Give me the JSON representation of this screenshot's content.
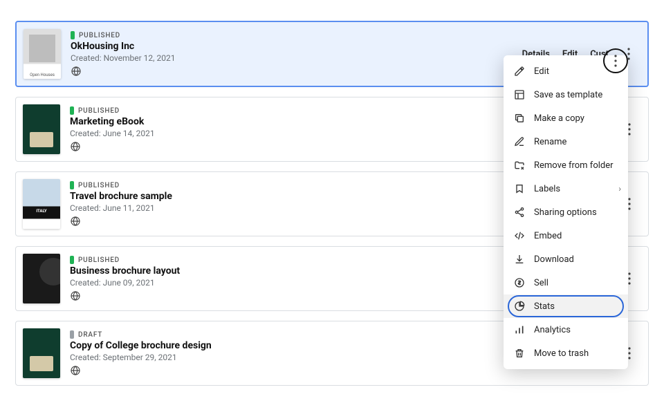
{
  "rows": [
    {
      "status": "PUBLISHED",
      "statusClass": "published",
      "title": "OkHousing Inc",
      "created": "Created: November 12, 2021",
      "thumb": "open-houses",
      "selected": true
    },
    {
      "status": "PUBLISHED",
      "statusClass": "published",
      "title": "Marketing eBook",
      "created": "Created: June 14, 2021",
      "thumb": "marketing",
      "selected": false
    },
    {
      "status": "PUBLISHED",
      "statusClass": "published",
      "title": "Travel brochure sample",
      "created": "Created: June 11, 2021",
      "thumb": "travel",
      "selected": false
    },
    {
      "status": "PUBLISHED",
      "statusClass": "published",
      "title": "Business brochure layout",
      "created": "Created: June 09, 2021",
      "thumb": "business",
      "selected": false
    },
    {
      "status": "DRAFT",
      "statusClass": "draft",
      "title": "Copy of College brochure design",
      "created": "Created: September 29, 2021",
      "thumb": "college",
      "selected": false
    }
  ],
  "actions": {
    "details": "Details",
    "edit": "Edit",
    "customize_partial": "Cust"
  },
  "menu": [
    {
      "icon": "edit",
      "label": "Edit"
    },
    {
      "icon": "template",
      "label": "Save as template"
    },
    {
      "icon": "copy",
      "label": "Make a copy"
    },
    {
      "icon": "rename",
      "label": "Rename"
    },
    {
      "icon": "remove-folder",
      "label": "Remove from folder"
    },
    {
      "icon": "labels",
      "label": "Labels",
      "submenu": true
    },
    {
      "icon": "share",
      "label": "Sharing options"
    },
    {
      "icon": "embed",
      "label": "Embed"
    },
    {
      "icon": "download",
      "label": "Download"
    },
    {
      "icon": "sell",
      "label": "Sell"
    },
    {
      "icon": "stats",
      "label": "Stats",
      "highlight": true
    },
    {
      "icon": "analytics",
      "label": "Analytics"
    },
    {
      "icon": "trash",
      "label": "Move to trash"
    }
  ]
}
